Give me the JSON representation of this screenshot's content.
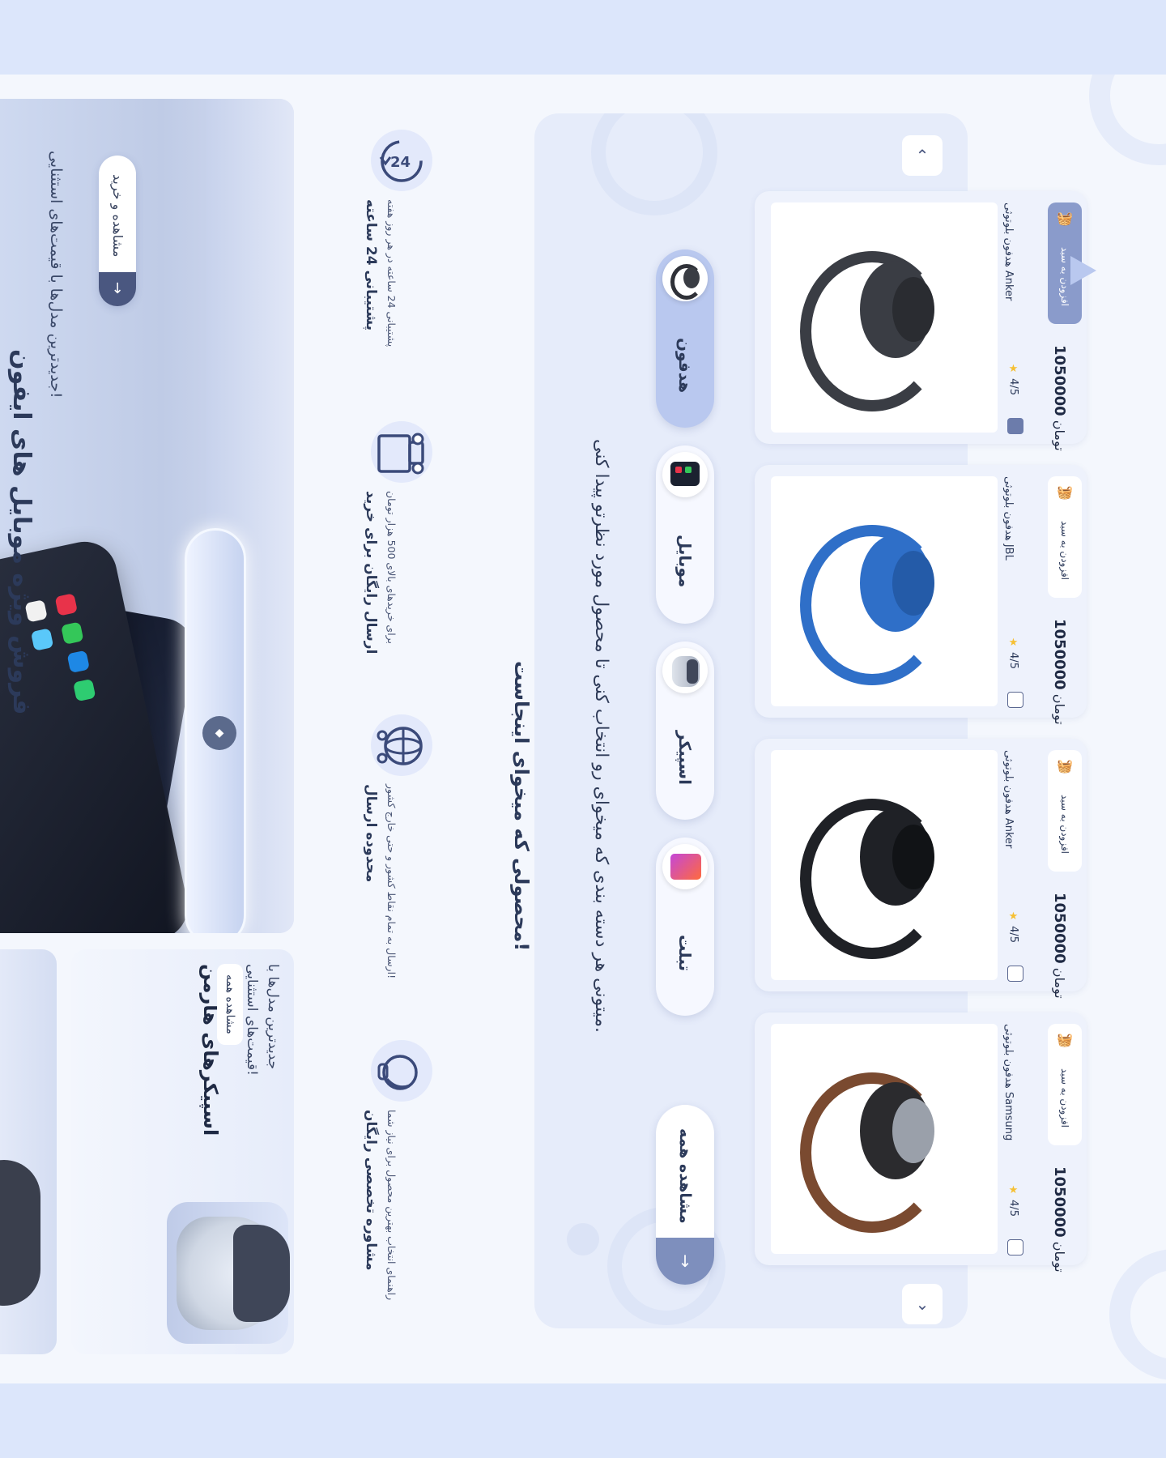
{
  "hero": {
    "title": "فروش ویژه موبایل های ایفون",
    "subtitle": "جدیدترین مدل‌ها با قیمت‌های استثنایی!",
    "button_label": "مشاهده و خرید",
    "button_icon": "arrow-down-icon"
  },
  "promo_speakers": {
    "title": "اسپیکرهای هارمن",
    "subtitle": "جدیدترین مدل‌ها با قیمت‌های استثنایی!",
    "button_label": "مشاهده همه"
  },
  "features": [
    {
      "icon": "support-24h-icon",
      "title": "پشتیبانی 24 ساعته",
      "desc": "پشتیبانی 24 ساعته در هر روز هفته"
    },
    {
      "icon": "delivery-truck-icon",
      "title": "ارسال رایگان برای خرید",
      "desc": "برای خریدهای بالای 500 هزار تومان"
    },
    {
      "icon": "globe-location-icon",
      "title": "محدوده ارسال",
      "desc": "ارسال به تمام نقاط کشور و حتی خارج کشور!"
    },
    {
      "icon": "headset-advisor-icon",
      "title": "مشاوره تخصصی رایگان",
      "desc": "راهنمای انتخاب بهترین محصول برای نیاز شما"
    }
  ],
  "section": {
    "title": "محصولی که میخوای اینجاست!",
    "description": "میتونی هر دسته بندی که میخوای رو انتخاب کنی تا محصول مورد نظرتو پیدا کنی."
  },
  "categories": [
    {
      "label": "هدفون",
      "active": true
    },
    {
      "label": "موبایل",
      "active": false
    },
    {
      "label": "اسپیکر",
      "active": false
    },
    {
      "label": "تبلت",
      "active": false
    }
  ],
  "see_all_label": "مشاهده همه",
  "nav": {
    "up_icon": "chevron-up-icon",
    "down_icon": "chevron-down-icon"
  },
  "products": [
    {
      "name": "هدفون بلوتوثی Anker",
      "rating": "4/5",
      "price": "1050000",
      "currency": "تومان",
      "add_label": "افزودن به سبد",
      "color": "#3a3d44"
    },
    {
      "name": "هدفون بلوتوثی JBL",
      "rating": "4/5",
      "price": "1050000",
      "currency": "تومان",
      "add_label": "افزودن به سبد",
      "color": "#2f6fc8"
    },
    {
      "name": "هدفون بلوتوثی Anker",
      "rating": "4/5",
      "price": "1050000",
      "currency": "تومان",
      "add_label": "افزودن به سبد",
      "color": "#1f2126"
    },
    {
      "name": "هدفون بلوتوثی Samsung",
      "rating": "4/5",
      "price": "1050000",
      "currency": "تومان",
      "add_label": "افزودن به سبد",
      "color": "#2b2b2e"
    }
  ]
}
